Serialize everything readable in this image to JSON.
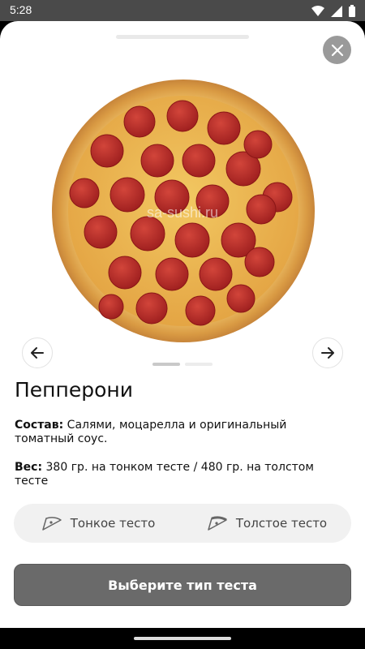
{
  "status_bar": {
    "time": "5:28"
  },
  "product": {
    "name": "Пепперони",
    "image_alt": "pizza-pepperoni",
    "watermark": "sa-sushi.ru",
    "composition_label": "Состав:",
    "composition_text": " Салями, моцарелла и оригинальный томатный соус.",
    "weight_label": "Вес:",
    "weight_text": " 380 гр. на тонком тесте / 480 гр. на толстом тесте"
  },
  "carousel": {
    "total": 2,
    "active_index": 0
  },
  "dough_options": [
    {
      "label": "Тонкое тесто",
      "icon": "pizza-slice-icon"
    },
    {
      "label": "Толстое тесто",
      "icon": "pizza-slice-icon"
    }
  ],
  "cta": {
    "label": "Выберите тип теста"
  },
  "colors": {
    "cta_bg": "#6a6a6a",
    "toggle_bg": "#f1f1f1",
    "close_bg": "#9a9a9a"
  }
}
